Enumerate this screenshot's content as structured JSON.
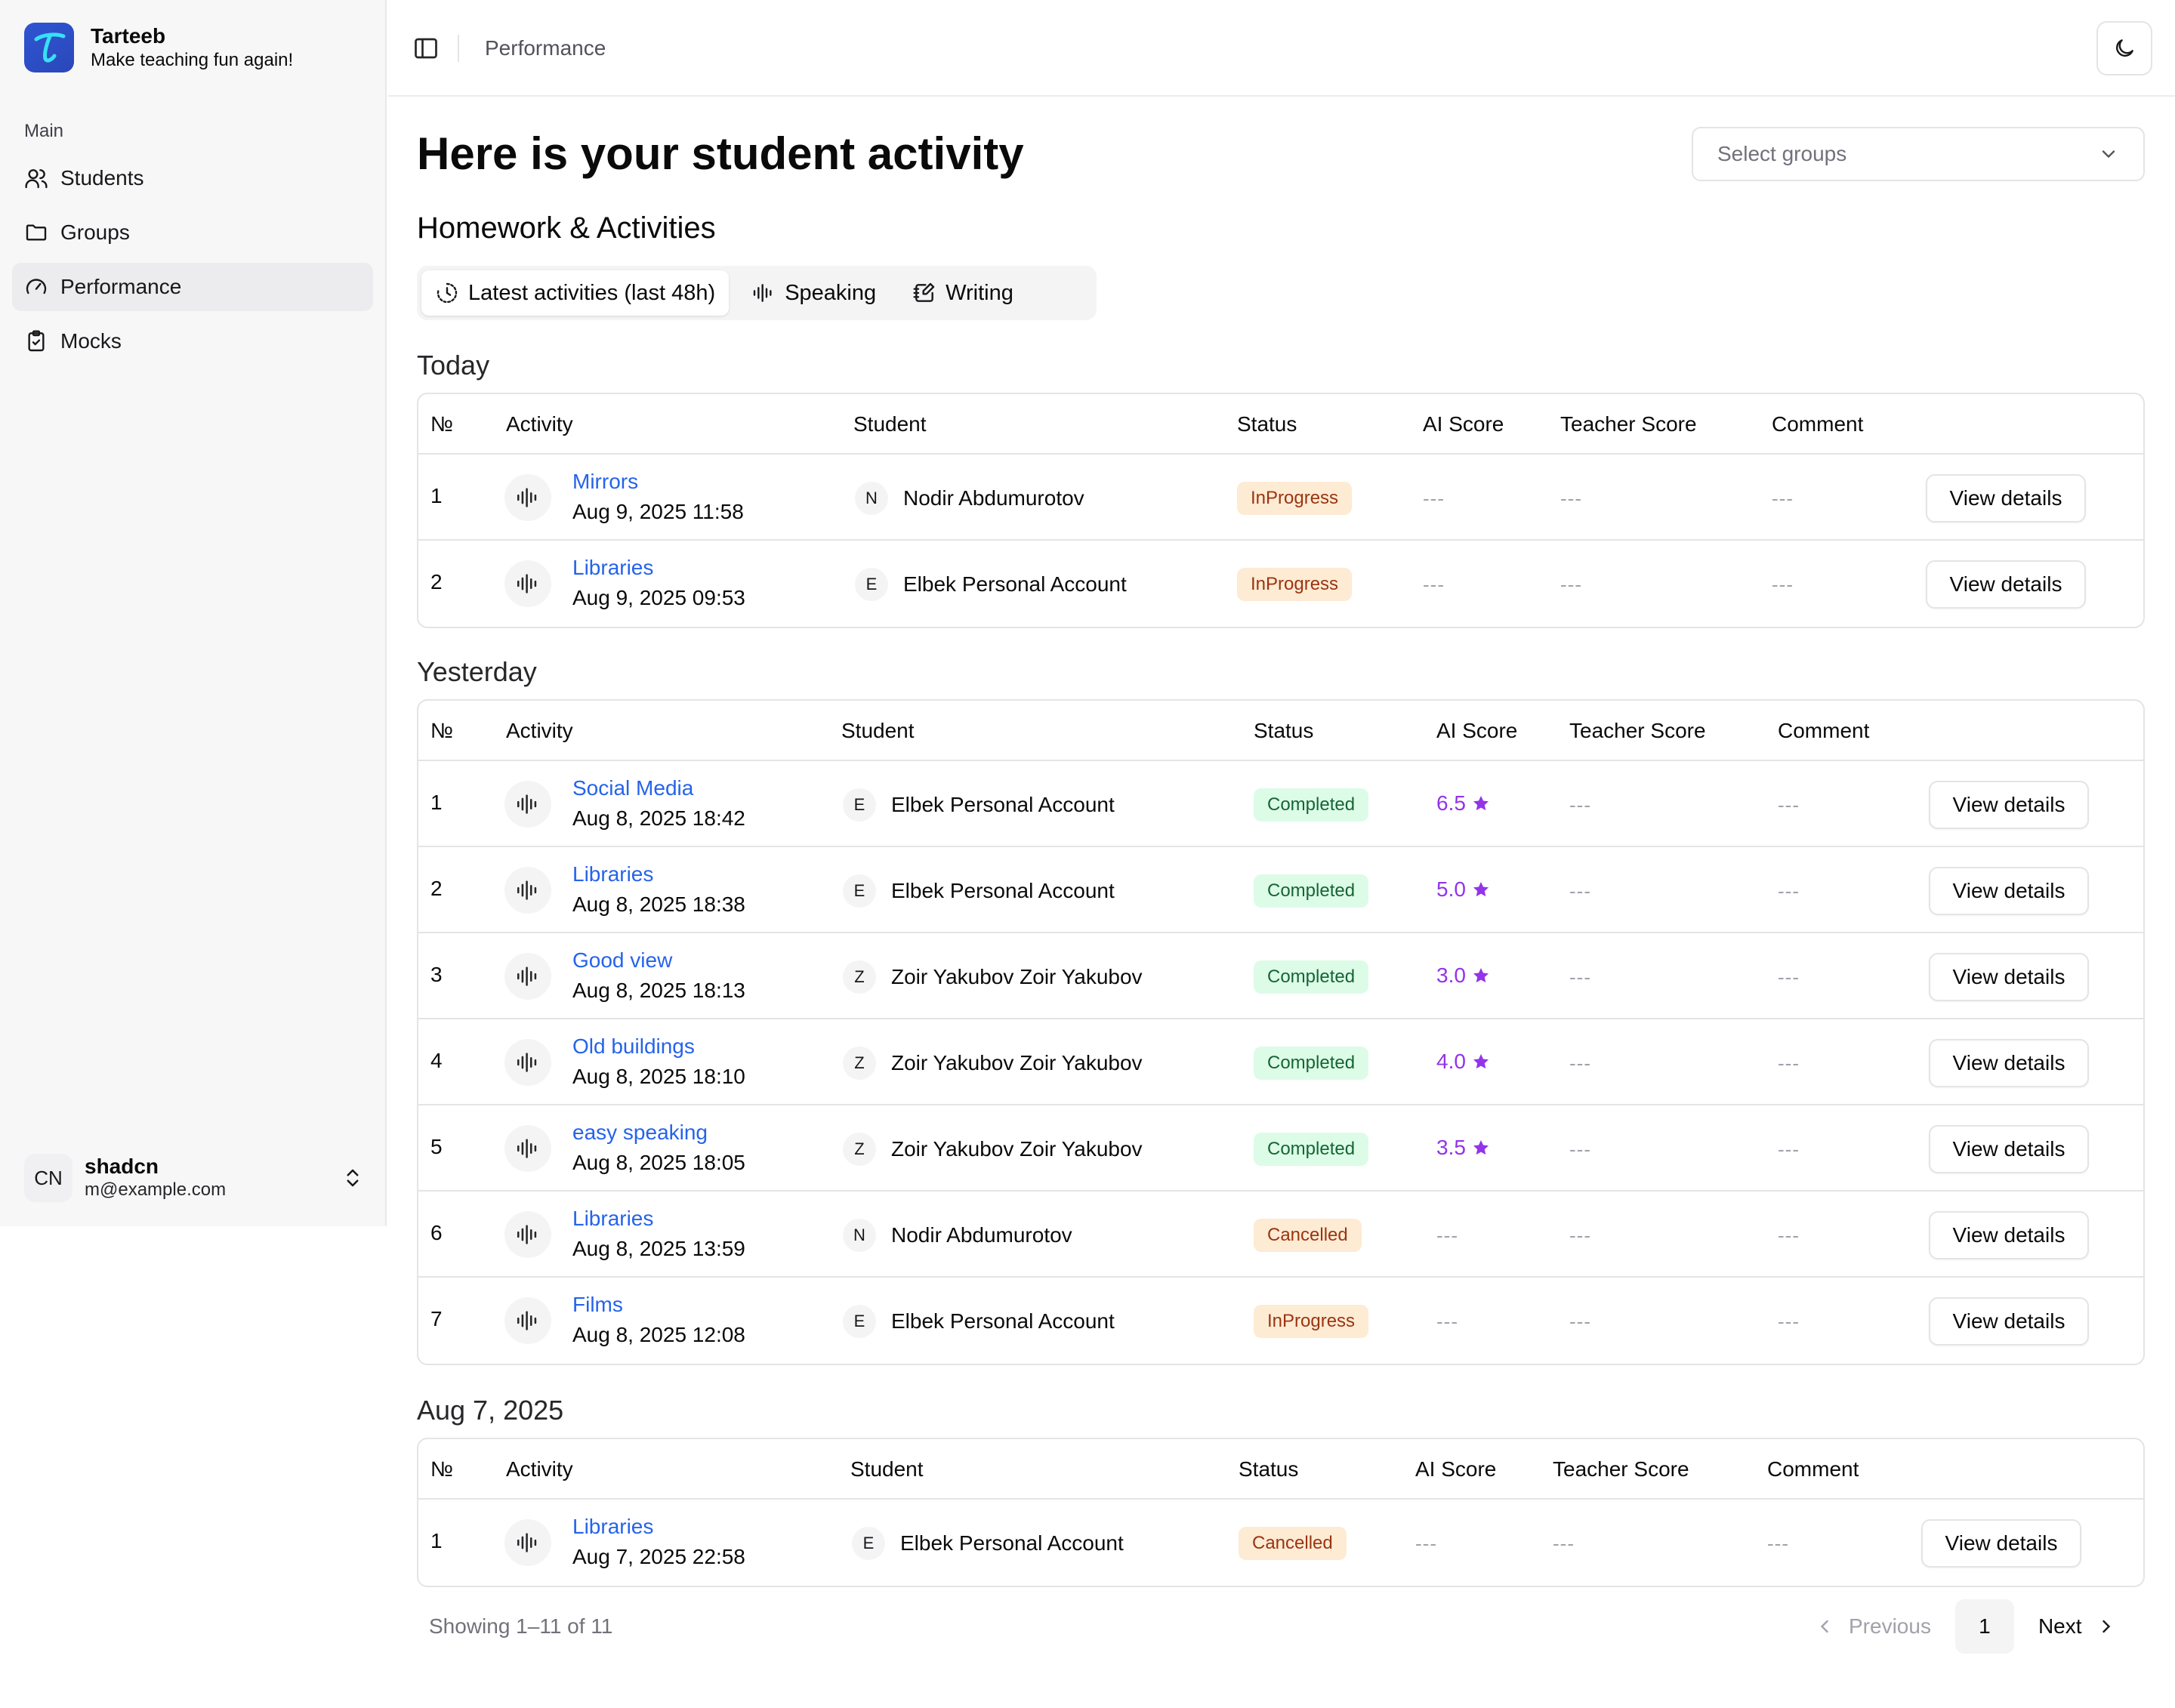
{
  "brand": {
    "name": "Tarteeb",
    "tagline": "Make teaching fun again!",
    "logo_letter": "T"
  },
  "sidebar": {
    "section": "Main",
    "items": [
      {
        "label": "Students",
        "icon": "users-icon"
      },
      {
        "label": "Groups",
        "icon": "folder-icon"
      },
      {
        "label": "Performance",
        "icon": "gauge-icon",
        "active": true
      },
      {
        "label": "Mocks",
        "icon": "clipboard-check-icon"
      }
    ],
    "user": {
      "initials": "CN",
      "name": "shadcn",
      "email": "m@example.com"
    }
  },
  "header": {
    "breadcrumb": "Performance"
  },
  "main": {
    "title": "Here is your student activity",
    "select_placeholder": "Select groups",
    "subtitle": "Homework & Activities",
    "tabs": [
      {
        "label": "Latest activities (last 48h)",
        "icon": "history-icon",
        "active": true
      },
      {
        "label": "Speaking",
        "icon": "audio-lines-icon"
      },
      {
        "label": "Writing",
        "icon": "notebook-pen-icon"
      }
    ],
    "columns": [
      "№",
      "Activity",
      "Student",
      "Status",
      "AI Score",
      "Teacher Score",
      "Comment"
    ],
    "empty": "---",
    "view_label": "View details",
    "groups": [
      {
        "label": "Today",
        "rows": [
          {
            "n": "1",
            "title": "Mirrors",
            "date": "Aug 9, 2025 11:58",
            "initial": "N",
            "student": "Nodir Abdumurotov",
            "status": "InProgress",
            "ai": null
          },
          {
            "n": "2",
            "title": "Libraries",
            "date": "Aug 9, 2025 09:53",
            "initial": "E",
            "student": "Elbek Personal Account",
            "status": "InProgress",
            "ai": null
          }
        ]
      },
      {
        "label": "Yesterday",
        "rows": [
          {
            "n": "1",
            "title": "Social Media",
            "date": "Aug 8, 2025 18:42",
            "initial": "E",
            "student": "Elbek Personal Account",
            "status": "Completed",
            "ai": "6.5"
          },
          {
            "n": "2",
            "title": "Libraries",
            "date": "Aug 8, 2025 18:38",
            "initial": "E",
            "student": "Elbek Personal Account",
            "status": "Completed",
            "ai": "5.0"
          },
          {
            "n": "3",
            "title": "Good view",
            "date": "Aug 8, 2025 18:13",
            "initial": "Z",
            "student": "Zoir Yakubov Zoir Yakubov",
            "status": "Completed",
            "ai": "3.0"
          },
          {
            "n": "4",
            "title": "Old buildings",
            "date": "Aug 8, 2025 18:10",
            "initial": "Z",
            "student": "Zoir Yakubov Zoir Yakubov",
            "status": "Completed",
            "ai": "4.0"
          },
          {
            "n": "5",
            "title": "easy speaking",
            "date": "Aug 8, 2025 18:05",
            "initial": "Z",
            "student": "Zoir Yakubov Zoir Yakubov",
            "status": "Completed",
            "ai": "3.5"
          },
          {
            "n": "6",
            "title": "Libraries",
            "date": "Aug 8, 2025 13:59",
            "initial": "N",
            "student": "Nodir Abdumurotov",
            "status": "Cancelled",
            "ai": null
          },
          {
            "n": "7",
            "title": "Films",
            "date": "Aug 8, 2025 12:08",
            "initial": "E",
            "student": "Elbek Personal Account",
            "status": "InProgress",
            "ai": null
          }
        ]
      },
      {
        "label": "Aug 7, 2025",
        "rows": [
          {
            "n": "1",
            "title": "Libraries",
            "date": "Aug 7, 2025 22:58",
            "initial": "E",
            "student": "Elbek Personal Account",
            "status": "Cancelled",
            "ai": null
          }
        ]
      }
    ],
    "footer": {
      "showing": "Showing 1–11 of 11",
      "previous": "Previous",
      "current_page": "1",
      "next": "Next"
    }
  },
  "colors": {
    "link": "#2563eb",
    "score": "#9333ea",
    "completed_bg": "#dcfce7",
    "warn_bg": "#fdebd3",
    "brand": "#2f55d4"
  }
}
